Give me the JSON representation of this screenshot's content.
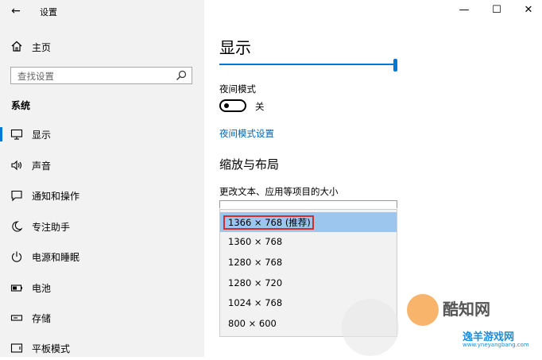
{
  "window": {
    "app_title": "设置",
    "back": "←",
    "minimize": "—",
    "maximize": "☐",
    "close": "✕"
  },
  "sidebar": {
    "home_label": "主页",
    "search_placeholder": "查找设置",
    "section": "系统",
    "items": [
      {
        "label": "显示",
        "icon": "monitor-icon",
        "selected": true
      },
      {
        "label": "声音",
        "icon": "speaker-icon",
        "selected": false
      },
      {
        "label": "通知和操作",
        "icon": "notification-icon",
        "selected": false
      },
      {
        "label": "专注助手",
        "icon": "moon-icon",
        "selected": false
      },
      {
        "label": "电源和睡眠",
        "icon": "power-icon",
        "selected": false
      },
      {
        "label": "电池",
        "icon": "battery-icon",
        "selected": false
      },
      {
        "label": "存储",
        "icon": "storage-icon",
        "selected": false
      },
      {
        "label": "平板模式",
        "icon": "tablet-icon",
        "selected": false
      }
    ]
  },
  "main": {
    "title": "显示",
    "night_mode_label": "夜间模式",
    "night_mode_state": "关",
    "night_mode_link": "夜间模式设置",
    "scale_section_title": "缩放与布局",
    "scale_label": "更改文本、应用等项目的大小",
    "resolution_options": [
      "1366 × 768 (推荐)",
      "1360 × 768",
      "1280 × 768",
      "1280 × 720",
      "1024 × 768",
      "800 × 600"
    ]
  },
  "watermark": {
    "brand": "酷知网",
    "sub": "逸羊游戏网",
    "url": "www.yneyangbang.com"
  },
  "colors": {
    "accent": "#0078d7",
    "link": "#0066b4",
    "selected_option": "#9dc6ef",
    "highlight": "#d42d2d"
  }
}
